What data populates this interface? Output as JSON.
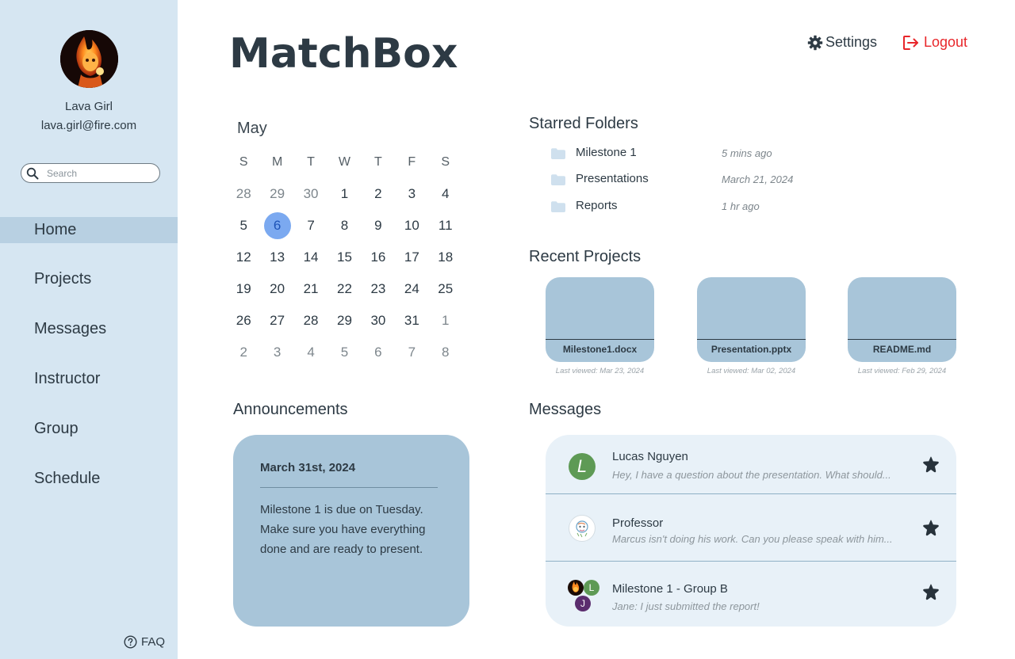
{
  "app": {
    "title": "MatchBox"
  },
  "header": {
    "settings_label": "Settings",
    "logout_label": "Logout"
  },
  "user": {
    "name": "Lava Girl",
    "email": "lava.girl@fire.com"
  },
  "search": {
    "placeholder": "Search",
    "value": ""
  },
  "sidebar": {
    "items": [
      {
        "label": "Home",
        "active": true
      },
      {
        "label": "Projects"
      },
      {
        "label": "Messages"
      },
      {
        "label": "Instructor"
      },
      {
        "label": "Group"
      },
      {
        "label": "Schedule"
      }
    ],
    "faq_label": "FAQ"
  },
  "calendar": {
    "month": "May",
    "weekdays": [
      "S",
      "M",
      "T",
      "W",
      "T",
      "F",
      "S"
    ],
    "weeks": [
      [
        "28",
        "29",
        "30",
        "1",
        "2",
        "3",
        "4"
      ],
      [
        "5",
        "6",
        "7",
        "8",
        "9",
        "10",
        "11"
      ],
      [
        "12",
        "13",
        "14",
        "15",
        "16",
        "17",
        "18"
      ],
      [
        "19",
        "20",
        "21",
        "22",
        "23",
        "24",
        "25"
      ],
      [
        "26",
        "27",
        "28",
        "29",
        "30",
        "31",
        "1"
      ],
      [
        "2",
        "3",
        "4",
        "5",
        "6",
        "7",
        "8"
      ]
    ],
    "today": "6"
  },
  "announcements": {
    "title": "Announcements",
    "date": "March 31st, 2024",
    "body": "Milestone 1 is due on Tuesday. Make sure you have everything done and are ready to present."
  },
  "starred": {
    "title": "Starred Folders",
    "folders": [
      {
        "name": "Milestone 1",
        "time": "5 mins ago"
      },
      {
        "name": "Presentations",
        "time": "March 21, 2024"
      },
      {
        "name": "Reports",
        "time": "1 hr ago"
      }
    ]
  },
  "projects": {
    "title": "Recent Projects",
    "items": [
      {
        "name": "Milestone1.docx",
        "viewed": "Last viewed: Mar 23, 2024"
      },
      {
        "name": "Presentation.pptx",
        "viewed": "Last viewed: Mar 02, 2024"
      },
      {
        "name": "README.md",
        "viewed": "Last viewed: Feb 29, 2024"
      }
    ]
  },
  "messages": {
    "title": "Messages",
    "items": [
      {
        "name": "Lucas Nguyen",
        "preview": "Hey, I have a question about the presentation. What should...",
        "avatar_letter": "L"
      },
      {
        "name": "Professor",
        "preview": "Marcus isn't doing his work. Can you please speak with him...",
        "avatar_letter": ""
      },
      {
        "name": "Milestone 1 - Group B",
        "preview": "Jane: I just submitted the report!",
        "avatar_letters": [
          "L",
          "J"
        ]
      }
    ]
  },
  "colors": {
    "sidebar_bg": "#d6e6f2",
    "accent_card": "#a8c5d9",
    "today_circle": "#7ba9f0",
    "logout_red": "#e8262a",
    "text": "#2d3a44"
  }
}
